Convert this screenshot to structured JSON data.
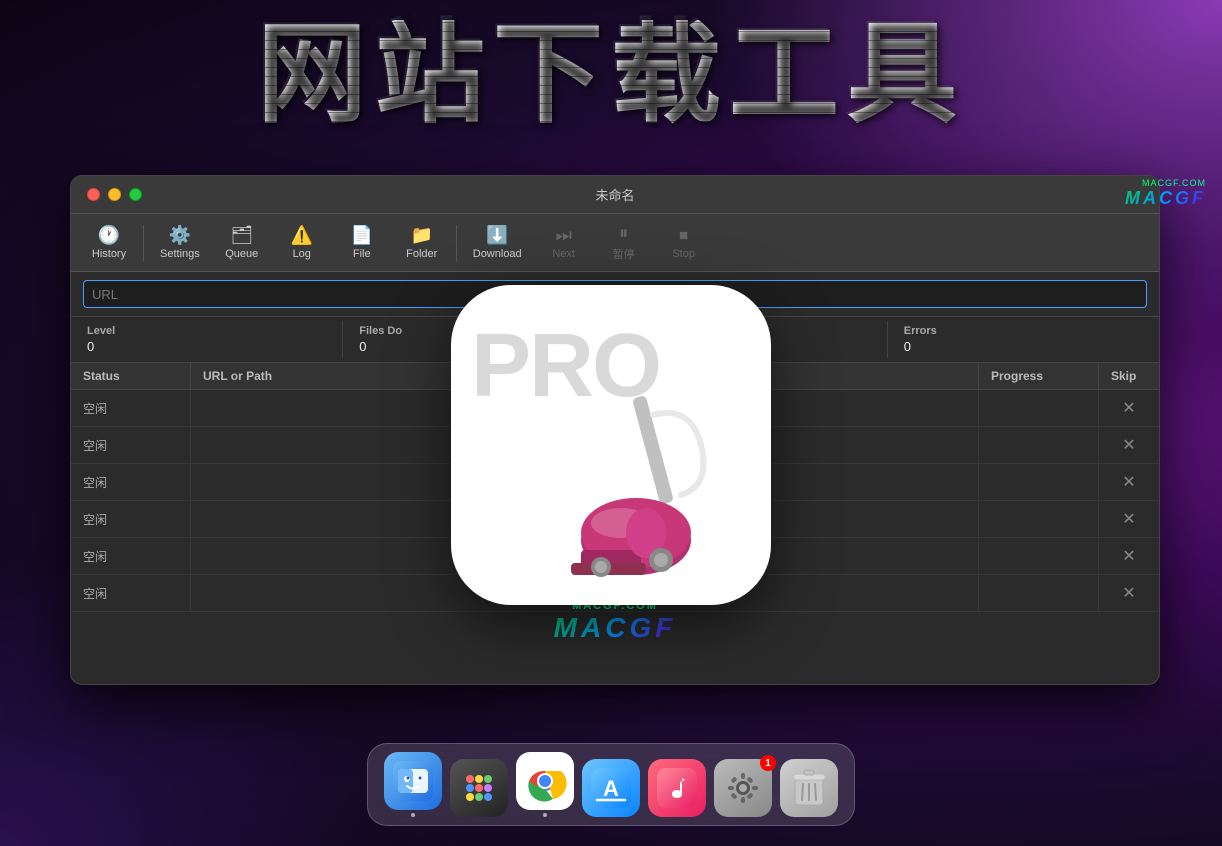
{
  "background": {
    "color_primary": "#1a0a2e",
    "color_accent": "#6b1a8a"
  },
  "title": {
    "text": "网站下载工具"
  },
  "window": {
    "title": "未命名",
    "traffic_lights": [
      "red",
      "yellow",
      "green"
    ],
    "toolbar": {
      "buttons": [
        {
          "id": "history",
          "label": "History",
          "icon": "🕐",
          "enabled": true
        },
        {
          "id": "settings",
          "label": "Settings",
          "icon": "⚙️",
          "enabled": true
        },
        {
          "id": "queue",
          "label": "Queue",
          "icon": "🗂",
          "enabled": true
        },
        {
          "id": "log",
          "label": "Log",
          "icon": "⚠️",
          "enabled": true
        },
        {
          "id": "file",
          "label": "File",
          "icon": "📄",
          "enabled": true
        },
        {
          "id": "folder",
          "label": "Folder",
          "icon": "📁",
          "enabled": true
        },
        {
          "id": "download",
          "label": "Download",
          "icon": "⬇️",
          "enabled": true
        },
        {
          "id": "next",
          "label": "Next",
          "icon": "⏭",
          "enabled": false
        },
        {
          "id": "pause",
          "label": "暂停",
          "icon": "⏸",
          "enabled": false
        },
        {
          "id": "stop",
          "label": "Stop",
          "icon": "⏹",
          "enabled": false
        }
      ]
    },
    "url_placeholder": "URL",
    "watermark_top": {
      "domain": "MACGF.COM",
      "brand": "MACGF"
    },
    "stats": [
      {
        "label": "Level",
        "value": "0"
      },
      {
        "label": "Files Do",
        "value": "0"
      },
      {
        "label": "",
        "value": ""
      },
      {
        "label": "Errors",
        "value": "0"
      }
    ],
    "table": {
      "headers": [
        "Status",
        "URL or Path",
        "Progress",
        "Skip"
      ],
      "rows": [
        {
          "status": "空闲",
          "url": "",
          "progress": "",
          "skip": "×"
        },
        {
          "status": "空闲",
          "url": "",
          "progress": "",
          "skip": "×"
        },
        {
          "status": "空闲",
          "url": "",
          "progress": "",
          "skip": "×"
        },
        {
          "status": "空闲",
          "url": "",
          "progress": "",
          "skip": "×"
        },
        {
          "status": "空闲",
          "url": "",
          "progress": "",
          "skip": "×"
        },
        {
          "status": "空闲",
          "url": "",
          "progress": "",
          "skip": "×"
        }
      ]
    },
    "watermark_bottom": {
      "domain": "MACGF.COM",
      "brand": "MACGF"
    }
  },
  "app_icon": {
    "pro_text": "PRO",
    "description": "Website Downloader Pro app icon with vacuum cleaner"
  },
  "dock": {
    "items": [
      {
        "id": "finder",
        "name": "Finder",
        "has_dot": true,
        "badge": null
      },
      {
        "id": "launchpad",
        "name": "Launchpad",
        "has_dot": false,
        "badge": null
      },
      {
        "id": "chrome",
        "name": "Chrome",
        "has_dot": true,
        "badge": null
      },
      {
        "id": "appstore",
        "name": "App Store",
        "has_dot": false,
        "badge": null
      },
      {
        "id": "music",
        "name": "Music",
        "has_dot": false,
        "badge": null
      },
      {
        "id": "sysprefs",
        "name": "System Preferences",
        "has_dot": false,
        "badge": "1"
      },
      {
        "id": "trash",
        "name": "Trash",
        "has_dot": false,
        "badge": null
      }
    ]
  }
}
